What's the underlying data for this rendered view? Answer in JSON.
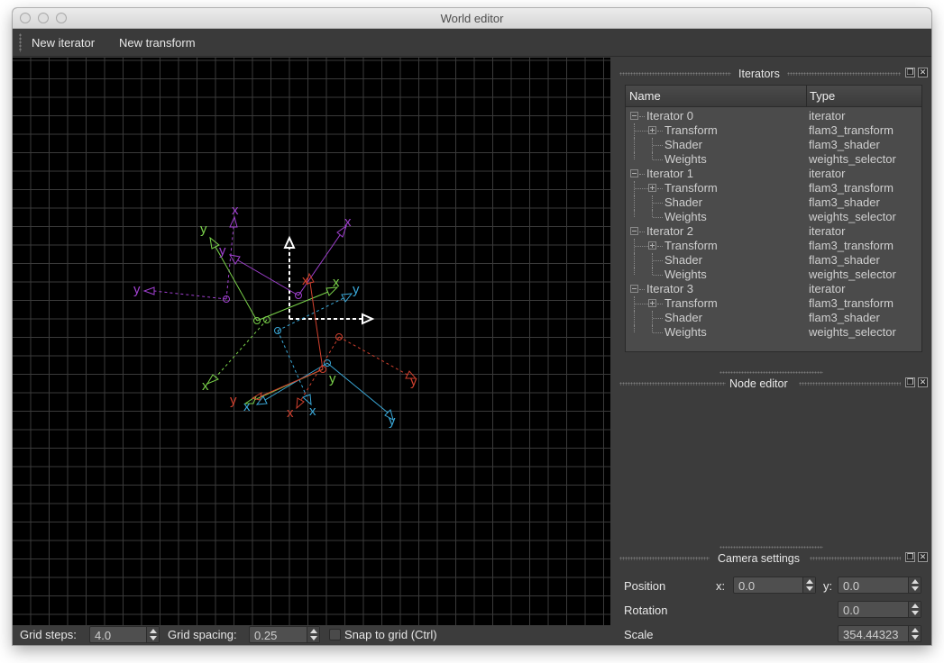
{
  "window": {
    "title": "World editor"
  },
  "toolbar": {
    "new_iterator": "New iterator",
    "new_transform": "New transform"
  },
  "viewport": {
    "grid_color": "#3a3a3a",
    "origin_color": "#ffffff",
    "axis_labels": {
      "purple_x": "x",
      "purple_y": "y",
      "purple_x2": "x",
      "purple_y2": "y",
      "green_x": "x",
      "green_y": "y",
      "green_x2": "x",
      "green_y2": "y",
      "cyan_x": "x",
      "cyan_y": "y",
      "cyan_x2": "x",
      "cyan_y2": "y",
      "red_x": "x",
      "red_y": "y",
      "red_x2": "x",
      "red_y2": "y"
    },
    "colors": {
      "purple": "#a040d0",
      "green": "#7ad24a",
      "cyan": "#3aa8d8",
      "red": "#d0402e"
    }
  },
  "statusbar": {
    "grid_steps_label": "Grid steps:",
    "grid_steps_value": "4.0",
    "grid_spacing_label": "Grid spacing:",
    "grid_spacing_value": "0.25",
    "snap_label": "Snap to grid (Ctrl)",
    "snap_checked": false
  },
  "iterators_dock": {
    "title": "Iterators",
    "columns": {
      "name": "Name",
      "type": "Type"
    },
    "rows": [
      {
        "name": "Iterator 0",
        "type": "iterator"
      },
      {
        "name": "Transform",
        "type": "flam3_transform"
      },
      {
        "name": "Shader",
        "type": "flam3_shader"
      },
      {
        "name": "Weights",
        "type": "weights_selector"
      },
      {
        "name": "Iterator 1",
        "type": "iterator"
      },
      {
        "name": "Transform",
        "type": "flam3_transform"
      },
      {
        "name": "Shader",
        "type": "flam3_shader"
      },
      {
        "name": "Weights",
        "type": "weights_selector"
      },
      {
        "name": "Iterator 2",
        "type": "iterator"
      },
      {
        "name": "Transform",
        "type": "flam3_transform"
      },
      {
        "name": "Shader",
        "type": "flam3_shader"
      },
      {
        "name": "Weights",
        "type": "weights_selector"
      },
      {
        "name": "Iterator 3",
        "type": "iterator"
      },
      {
        "name": "Transform",
        "type": "flam3_transform"
      },
      {
        "name": "Shader",
        "type": "flam3_shader"
      },
      {
        "name": "Weights",
        "type": "weights_selector"
      }
    ]
  },
  "node_editor_dock": {
    "title": "Node editor"
  },
  "camera_dock": {
    "title": "Camera settings",
    "position_label": "Position",
    "x_label": "x:",
    "x_value": "0.0",
    "y_label": "y:",
    "y_value": "0.0",
    "rotation_label": "Rotation",
    "rotation_value": "0.0",
    "scale_label": "Scale",
    "scale_value": "354.44323"
  }
}
